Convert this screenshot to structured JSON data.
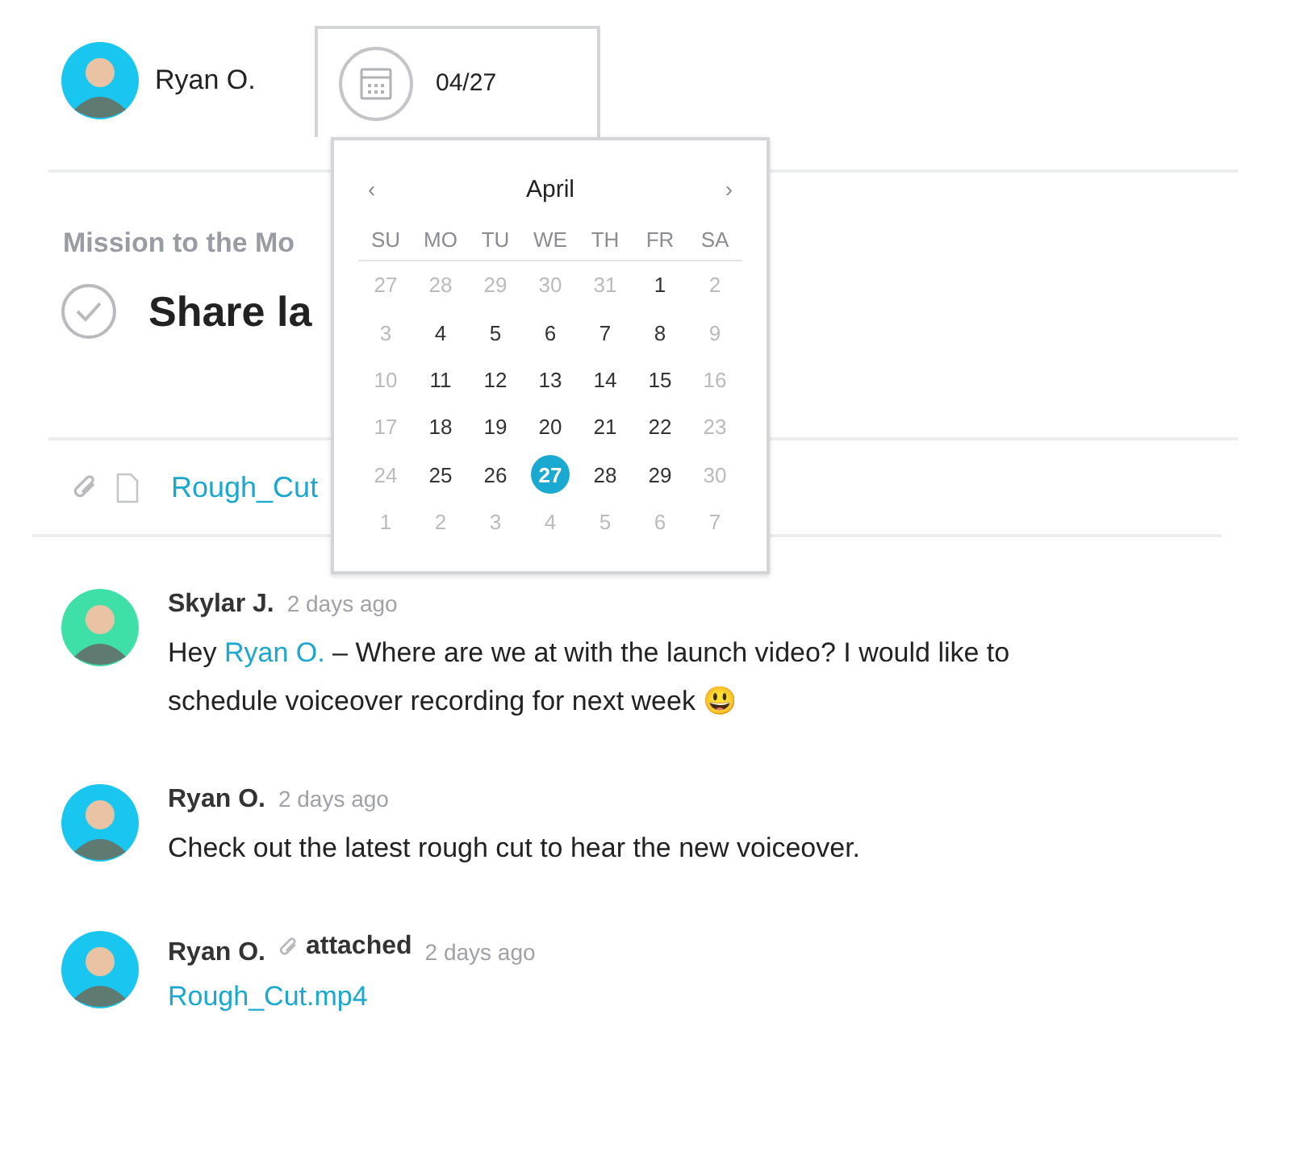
{
  "assignee": {
    "name": "Ryan O.",
    "color": "#19c6f0"
  },
  "due_date": {
    "value": "04/27"
  },
  "calendar": {
    "prev": "‹",
    "next": "›",
    "month": "April",
    "weekdays": [
      "SU",
      "MO",
      "TU",
      "WE",
      "TH",
      "FR",
      "SA"
    ],
    "days": [
      {
        "label": "27",
        "muted": true,
        "selected": false
      },
      {
        "label": "28",
        "muted": true,
        "selected": false
      },
      {
        "label": "29",
        "muted": true,
        "selected": false
      },
      {
        "label": "30",
        "muted": true,
        "selected": false
      },
      {
        "label": "31",
        "muted": true,
        "selected": false
      },
      {
        "label": "1",
        "muted": false,
        "selected": false
      },
      {
        "label": "2",
        "muted": true,
        "selected": false
      },
      {
        "label": "3",
        "muted": true,
        "selected": false
      },
      {
        "label": "4",
        "muted": false,
        "selected": false
      },
      {
        "label": "5",
        "muted": false,
        "selected": false
      },
      {
        "label": "6",
        "muted": false,
        "selected": false
      },
      {
        "label": "7",
        "muted": false,
        "selected": false
      },
      {
        "label": "8",
        "muted": false,
        "selected": false
      },
      {
        "label": "9",
        "muted": true,
        "selected": false
      },
      {
        "label": "10",
        "muted": true,
        "selected": false
      },
      {
        "label": "11",
        "muted": false,
        "selected": false
      },
      {
        "label": "12",
        "muted": false,
        "selected": false
      },
      {
        "label": "13",
        "muted": false,
        "selected": false
      },
      {
        "label": "14",
        "muted": false,
        "selected": false
      },
      {
        "label": "15",
        "muted": false,
        "selected": false
      },
      {
        "label": "16",
        "muted": true,
        "selected": false
      },
      {
        "label": "17",
        "muted": true,
        "selected": false
      },
      {
        "label": "18",
        "muted": false,
        "selected": false
      },
      {
        "label": "19",
        "muted": false,
        "selected": false
      },
      {
        "label": "20",
        "muted": false,
        "selected": false
      },
      {
        "label": "21",
        "muted": false,
        "selected": false
      },
      {
        "label": "22",
        "muted": false,
        "selected": false
      },
      {
        "label": "23",
        "muted": true,
        "selected": false
      },
      {
        "label": "24",
        "muted": true,
        "selected": false
      },
      {
        "label": "25",
        "muted": false,
        "selected": false
      },
      {
        "label": "26",
        "muted": false,
        "selected": false
      },
      {
        "label": "27",
        "muted": false,
        "selected": true
      },
      {
        "label": "28",
        "muted": false,
        "selected": false
      },
      {
        "label": "29",
        "muted": false,
        "selected": false
      },
      {
        "label": "30",
        "muted": true,
        "selected": false
      },
      {
        "label": "1",
        "muted": true,
        "selected": false
      },
      {
        "label": "2",
        "muted": true,
        "selected": false
      },
      {
        "label": "3",
        "muted": true,
        "selected": false
      },
      {
        "label": "4",
        "muted": true,
        "selected": false
      },
      {
        "label": "5",
        "muted": true,
        "selected": false
      },
      {
        "label": "6",
        "muted": true,
        "selected": false
      },
      {
        "label": "7",
        "muted": true,
        "selected": false
      }
    ]
  },
  "project": "Mission to the Mo",
  "task": {
    "title": "Share la",
    "completed": false
  },
  "attachment": {
    "name": "Rough_Cut"
  },
  "comments": [
    {
      "author": "Skylar J.",
      "color": "#3ee0a8",
      "time": "2 days ago",
      "kind": "message",
      "body": [
        {
          "kind": "text",
          "text": "Hey "
        },
        {
          "kind": "mention",
          "text": "Ryan O."
        },
        {
          "kind": "text",
          "text": " – Where are we at with the launch video? I would like to schedule voiceover recording for next week 😃"
        }
      ]
    },
    {
      "author": "Ryan O.",
      "color": "#19c6f0",
      "time": "2 days ago",
      "kind": "message",
      "body": [
        {
          "kind": "text",
          "text": "Check out the latest rough cut to hear the new voiceover."
        }
      ]
    },
    {
      "author": "Ryan O.",
      "color": "#19c6f0",
      "time": "2 days ago",
      "kind": "attachment",
      "action": "attached",
      "file": "Rough_Cut.mp4"
    }
  ]
}
